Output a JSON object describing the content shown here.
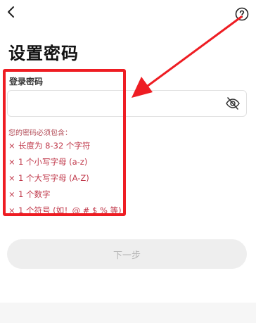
{
  "header": {
    "back_icon": "chevron-left-icon",
    "help_icon": "question-circle-icon"
  },
  "title": "设置密码",
  "form": {
    "label": "登录密码",
    "password_value": "",
    "placeholder": "",
    "visibility_icon": "eye-off-icon"
  },
  "rules": {
    "title": "您的密码必须包含：",
    "mark": "×",
    "items": [
      {
        "text": "长度为 8-32 个字符"
      },
      {
        "text": "1 个小写字母 (a-z)"
      },
      {
        "text": "1 个大写字母 (A-Z)"
      },
      {
        "text": "1 个数字"
      },
      {
        "text": "1 个符号 (如！@ # $ % 等)"
      }
    ]
  },
  "next_button": {
    "label": "下一步",
    "enabled": false
  },
  "colors": {
    "accent": "#ee1d23",
    "rule_text": "#c0394b",
    "button_bg": "#eeeeee",
    "button_text": "#b5b5b5"
  }
}
